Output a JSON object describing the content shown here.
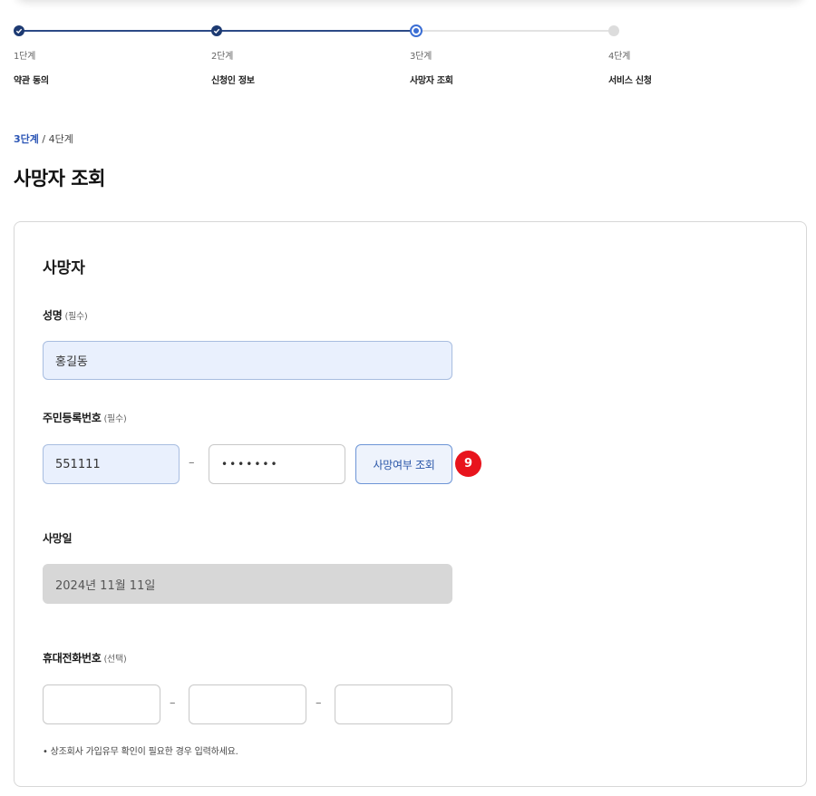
{
  "stepper": {
    "steps": [
      {
        "num": "1단계",
        "name": "약관 동의",
        "state": "done"
      },
      {
        "num": "2단계",
        "name": "신청인 정보",
        "state": "done"
      },
      {
        "num": "3단계",
        "name": "사망자 조회",
        "state": "current"
      },
      {
        "num": "4단계",
        "name": "서비스 신청",
        "state": "todo"
      }
    ]
  },
  "progress": {
    "current": "3단계",
    "separator": " / ",
    "total": "4단계"
  },
  "page_title": "사망자 조회",
  "form": {
    "section_title": "사망자",
    "name": {
      "label": "성명",
      "required": "(필수)",
      "value": "홍길동"
    },
    "rrn": {
      "label": "주민등록번호",
      "required": "(필수)",
      "front": "551111",
      "dash": "–",
      "back": "•••••••",
      "check_label": "사망여부 조회",
      "badge": "9"
    },
    "death_date": {
      "label": "사망일",
      "value": "2024년 11월 11일"
    },
    "phone": {
      "label": "휴대전화번호",
      "optional": "(선택)",
      "dash1": "–",
      "dash2": "–",
      "note": "• 상조회사 가입유무 확인이 필요한 경우 입력하세요."
    }
  },
  "colors": {
    "accent": "#2b55b5",
    "done": "#1d3a72",
    "badge": "#e8141d"
  }
}
